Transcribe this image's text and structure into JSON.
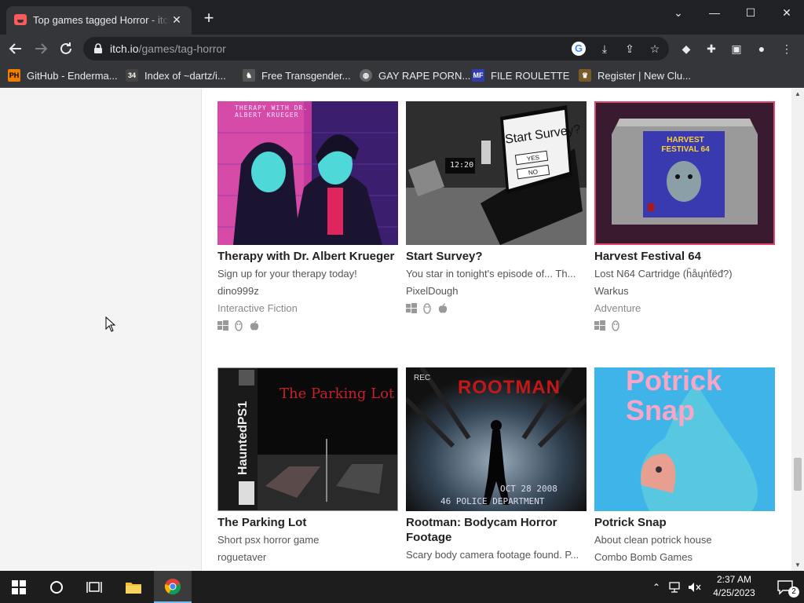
{
  "browser": {
    "tab_title": "Top games tagged Horror - itch.io",
    "tab_close": "✕",
    "new_tab": "+",
    "url_host": "itch.io",
    "url_path": "/games/tag-horror",
    "window_controls": {
      "minimize": "—",
      "maximize": "☐",
      "close": "✕",
      "tab_search": "⌄"
    }
  },
  "bookmarks": [
    {
      "icon": "PH",
      "label": "GitHub - Enderma...",
      "icon_color": "#f07c00"
    },
    {
      "icon": "34",
      "label": "Index of ~dartz/i...",
      "icon_color": "#444444"
    },
    {
      "icon": "♞",
      "label": "Free Transgender...",
      "icon_color": "#555555"
    },
    {
      "icon": "◍",
      "label": "GAY RAPE PORN...",
      "icon_color": "#666666"
    },
    {
      "icon": "MF",
      "label": "FILE ROULETTE",
      "icon_color": "#2f3db0"
    },
    {
      "icon": "♛",
      "label": "Register | New Clu...",
      "icon_color": "#7a5a2a"
    }
  ],
  "games": [
    {
      "title": "Therapy with Dr. Albert Krueger",
      "desc": "Sign up for your therapy today!",
      "author": "dino999z",
      "genre": "Interactive Fiction",
      "platforms": [
        "windows",
        "linux",
        "apple"
      ],
      "art_text": "THERAPY WITH DR. ALBERT KRUEGER"
    },
    {
      "title": "Start Survey?",
      "desc": "You star in tonight's episode of... Th...",
      "author": "PixelDough",
      "genre": "",
      "platforms": [
        "windows",
        "linux",
        "apple"
      ],
      "art_text": "Start Survey?",
      "art_yes": "YES",
      "art_no": "NO",
      "art_clock": "12:20"
    },
    {
      "title": "Harvest Festival 64",
      "desc": "Lost N64 Cartridge (ĥåųṅƭëđ?)",
      "author": "Warkus",
      "genre": "Adventure",
      "platforms": [
        "windows",
        "linux"
      ],
      "art_text": "HARVEST FESTIVAL 64"
    },
    {
      "title": "The Parking Lot",
      "desc": "Short psx horror game",
      "author": "roguetaver",
      "genre": "",
      "platforms": [],
      "art_text": "The Parking Lot",
      "art_side": "HauntedPS1"
    },
    {
      "title": "Rootman: Bodycam Horror Footage",
      "desc": "Scary body camera footage found. P...",
      "author": "",
      "genre": "",
      "platforms": [],
      "art_text": "ROOTMAN",
      "art_rec": "REC",
      "art_date": "OCT 28 2008",
      "art_dept": "46 POLICE DEPARTMENT"
    },
    {
      "title": "Potrick Snap",
      "desc": "About clean potrick house",
      "author": "Combo Bomb Games",
      "genre": "",
      "platforms": [],
      "art_text1": "Potrick",
      "art_text2": "Snap"
    }
  ],
  "taskbar": {
    "time": "2:37 AM",
    "date": "4/25/2023",
    "notifications": "2"
  },
  "colors": {
    "chrome_dark": "#202124",
    "chrome_mid": "#35363a",
    "itch_red": "#fa5c5c"
  }
}
